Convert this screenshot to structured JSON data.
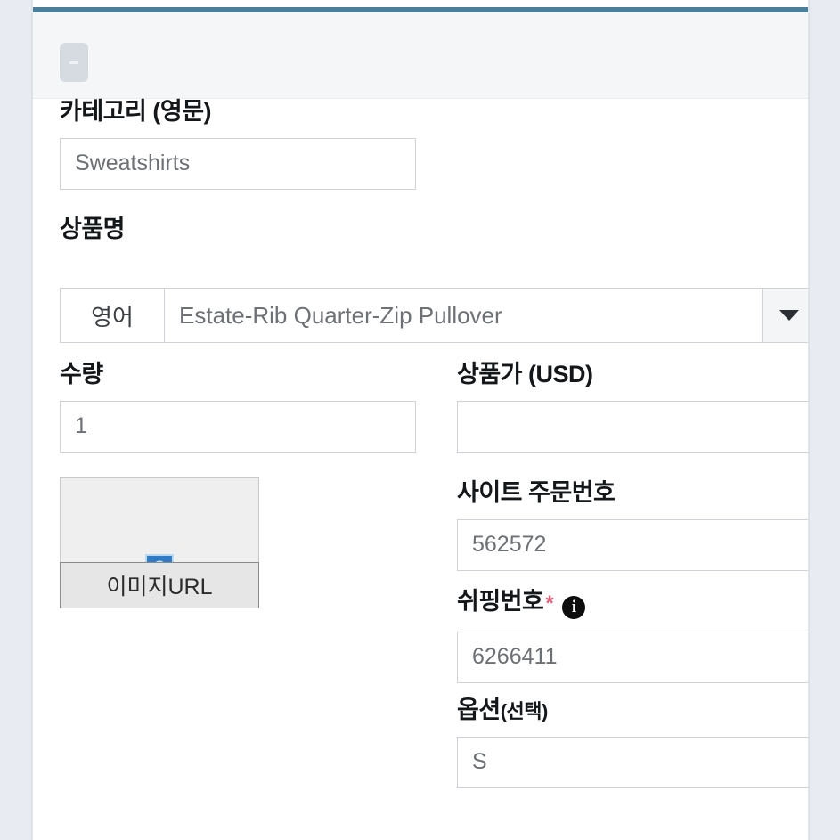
{
  "theme": {
    "page_background": "#e8ecf2",
    "card_background": "#ffffff",
    "accent_rule": "#4b7f99",
    "header_strip": "#f5f6f7",
    "required_marker": "#e0607a",
    "input_border": "#cfd2d6",
    "input_text": "#6d7175",
    "broken_image_blue": "#2f7bc6",
    "button_face": "#e6e6e6"
  },
  "header": {
    "collapse_button_label": "-"
  },
  "form": {
    "category": {
      "label": "카테고리 (영문)",
      "value": "Sweatshirts",
      "placeholder": "Sweatshirts"
    },
    "product_name": {
      "label": "상품명",
      "language_prefix": "영어",
      "value": "Estate-Rib Quarter-Zip Pullover",
      "placeholder": "Estate-Rib Quarter-Zip Pullover",
      "dropdown_icon": "chevron-down-icon"
    },
    "quantity": {
      "label": "수량",
      "value": "1",
      "placeholder": "1"
    },
    "price_usd": {
      "label": "상품가 (USD)",
      "value": "",
      "placeholder": ""
    },
    "image_url": {
      "button_label": "이미지URL",
      "placeholder_icon": "broken-image-icon",
      "placeholder_icon_glyph": "?"
    },
    "site_order_number": {
      "label": "사이트 주문번호",
      "value": "562572",
      "placeholder": "562572"
    },
    "shipping_number": {
      "label": "쉬핑번호",
      "required_marker": "*",
      "info_icon": "info-icon",
      "info_icon_glyph": "i",
      "value": "6266411",
      "placeholder": "6266411"
    },
    "option": {
      "label_main": "옵션",
      "label_sub": "(선택)",
      "value": "S",
      "placeholder": "S"
    }
  }
}
